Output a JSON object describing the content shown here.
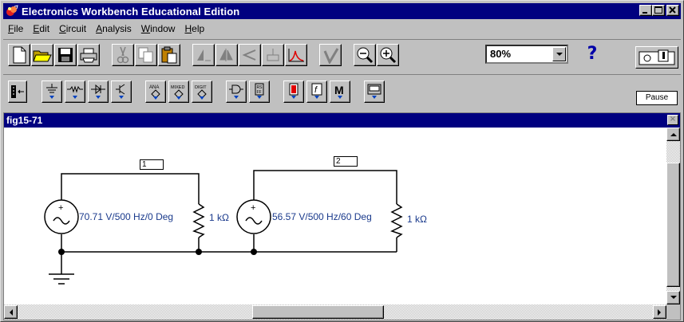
{
  "app": {
    "title": "Electronics Workbench Educational Edition",
    "window_buttons": [
      "minimize",
      "maximize",
      "close"
    ]
  },
  "menu": [
    {
      "label": "File",
      "key": "F",
      "rest": "ile"
    },
    {
      "label": "Edit",
      "key": "E",
      "rest": "dit"
    },
    {
      "label": "Circuit",
      "key": "C",
      "rest": "ircuit"
    },
    {
      "label": "Analysis",
      "key": "A",
      "rest": "nalysis"
    },
    {
      "label": "Window",
      "key": "W",
      "rest": "indow"
    },
    {
      "label": "Help",
      "key": "H",
      "rest": "elp"
    }
  ],
  "toolbar": {
    "zoom_value": "80%",
    "help_label": "?",
    "pause_label": "Pause"
  },
  "document": {
    "title": "fig15-71",
    "nodes": [
      "1",
      "2"
    ],
    "source1_label": "70.71 V/500 Hz/0 Deg",
    "resistor1_label": "1 kΩ",
    "source2_label": "56.57 V/500 Hz/60 Deg",
    "resistor2_label": "1 kΩ"
  },
  "colors": {
    "titlebar": "#000080",
    "face": "#c0c0c0",
    "label_text": "#1a3a8c"
  }
}
